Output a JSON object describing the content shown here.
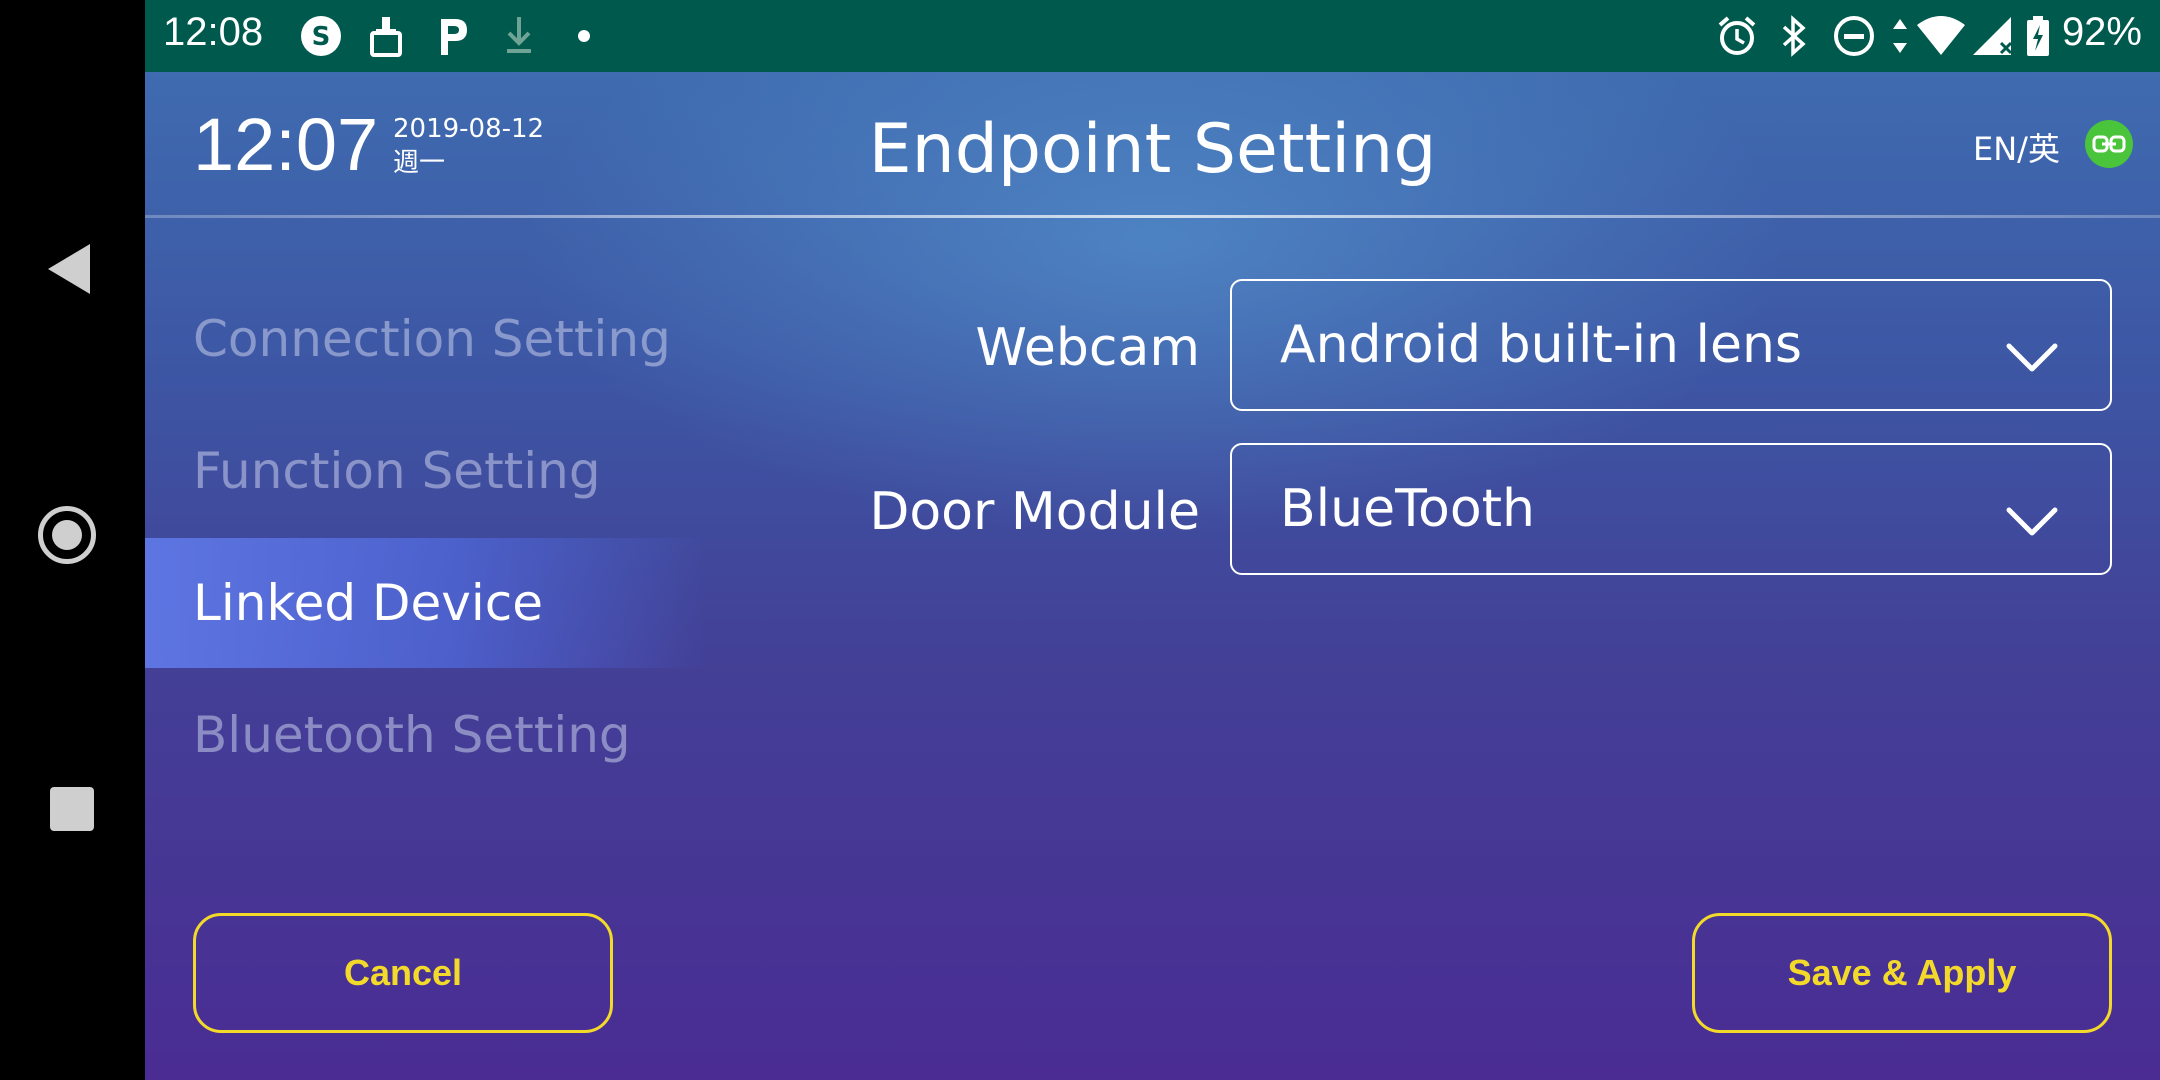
{
  "status_bar": {
    "time": "12:08",
    "battery_percent": "92%",
    "left_icons": [
      "s-app-icon",
      "cleaner-icon",
      "p-app-icon",
      "download-icon",
      "dot-icon"
    ],
    "right_icons": [
      "alarm-icon",
      "bluetooth-icon",
      "do-not-disturb-icon",
      "data-arrows-icon",
      "wifi-icon",
      "signal-icon",
      "battery-icon"
    ]
  },
  "header": {
    "time": "12:07",
    "date": "2019-08-12",
    "weekday": "週一",
    "title": "Endpoint Setting",
    "language": "EN/英",
    "link_status_color": "#49c43b"
  },
  "menu": {
    "items": [
      {
        "label": "Connection Setting",
        "active": false
      },
      {
        "label": "Function Setting",
        "active": false
      },
      {
        "label": "Linked Device",
        "active": true
      },
      {
        "label": "Bluetooth Setting",
        "active": false
      }
    ]
  },
  "form": {
    "webcam": {
      "label": "Webcam",
      "value": "Android built-in lens"
    },
    "door_module": {
      "label": "Door Module",
      "value": "BlueTooth"
    }
  },
  "buttons": {
    "cancel": "Cancel",
    "save": "Save & Apply"
  },
  "colors": {
    "status_bar_bg": "#00594d",
    "button_accent": "#f3da2a"
  }
}
